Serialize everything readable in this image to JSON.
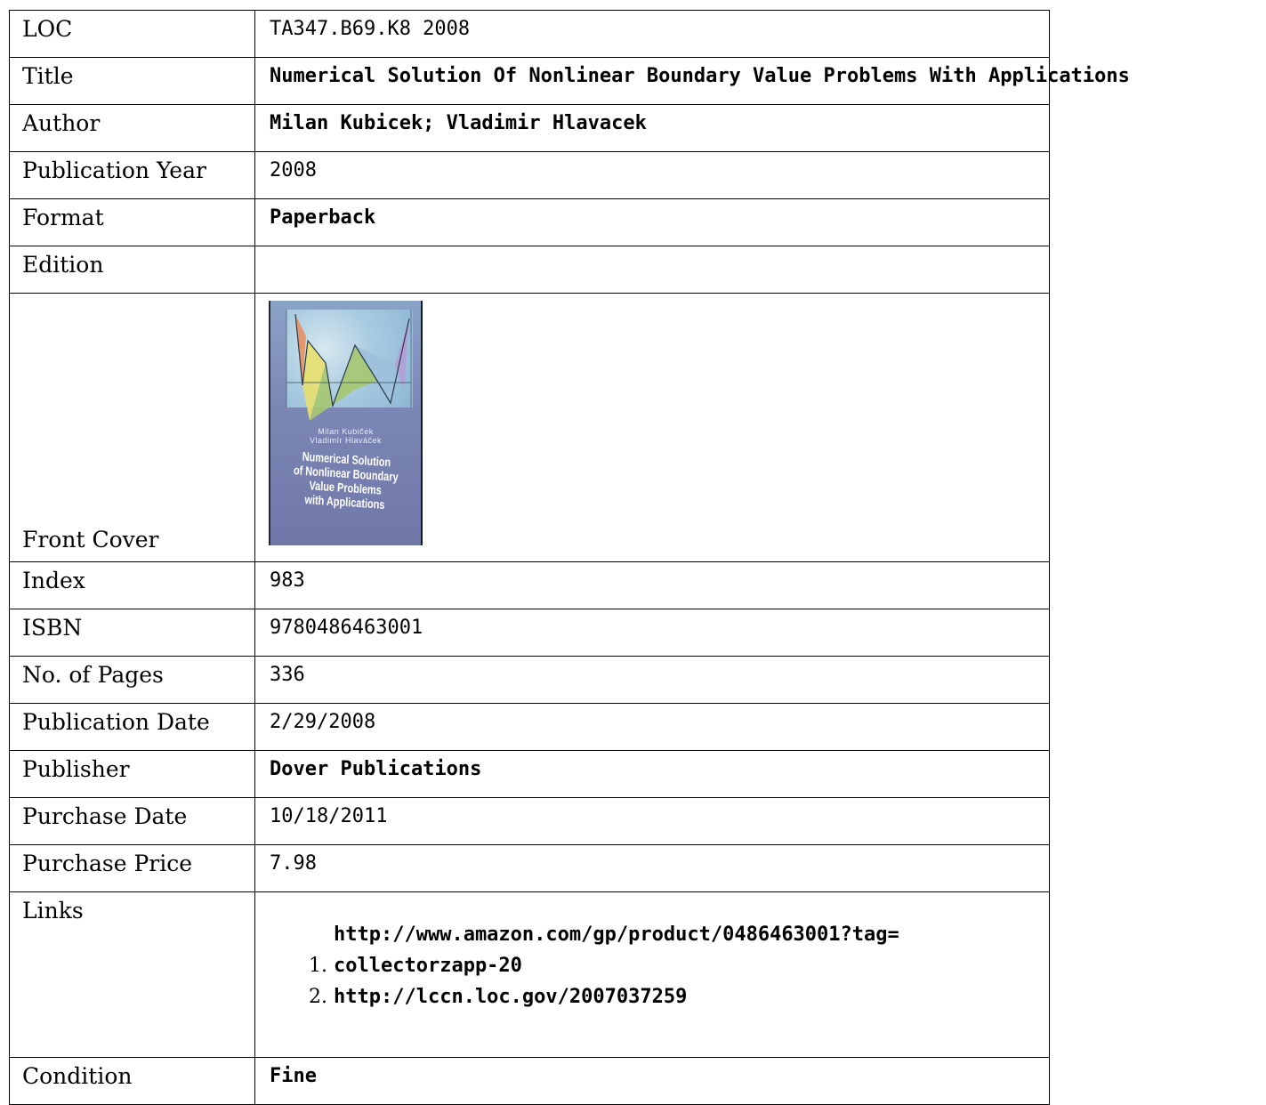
{
  "rows": {
    "loc": {
      "label": "LOC",
      "value": "TA347.B69.K8 2008"
    },
    "title": {
      "label": "Title",
      "value": "Numerical Solution Of Nonlinear Boundary Value Problems With Applications"
    },
    "author": {
      "label": "Author",
      "value": "Milan Kubicek; Vladimir Hlavacek"
    },
    "publication_year": {
      "label": "Publication Year",
      "value": "2008"
    },
    "format": {
      "label": "Format",
      "value": "Paperback"
    },
    "edition": {
      "label": "Edition",
      "value": ""
    },
    "front_cover": {
      "label": "Front Cover"
    },
    "index": {
      "label": "Index",
      "value": "983"
    },
    "isbn": {
      "label": "ISBN",
      "value": "9780486463001"
    },
    "pages": {
      "label": "No. of Pages",
      "value": "336"
    },
    "publication_date": {
      "label": "Publication Date",
      "value": "2/29/2008"
    },
    "publisher": {
      "label": "Publisher",
      "value": "Dover Publications"
    },
    "purchase_date": {
      "label": "Purchase Date",
      "value": "10/18/2011"
    },
    "purchase_price": {
      "label": "Purchase Price",
      "value": "7.98"
    },
    "links": {
      "label": "Links",
      "items": [
        {
          "url_line1": "http://www.amazon.com/gp/product/0486463001?tag=",
          "url_line2": "collectorzapp-20"
        },
        {
          "url_line1": "http://lccn.loc.gov/2007037259"
        }
      ]
    },
    "condition": {
      "label": "Condition",
      "value": "Fine"
    }
  },
  "cover": {
    "authors_line1": "Milan Kubiček",
    "authors_line2": "Vladimír Hlaváček",
    "title_line1": "Numerical Solution",
    "title_line2": "of Nonlinear Boundary",
    "title_line3": "Value Problems",
    "title_line4": "with Applications"
  }
}
